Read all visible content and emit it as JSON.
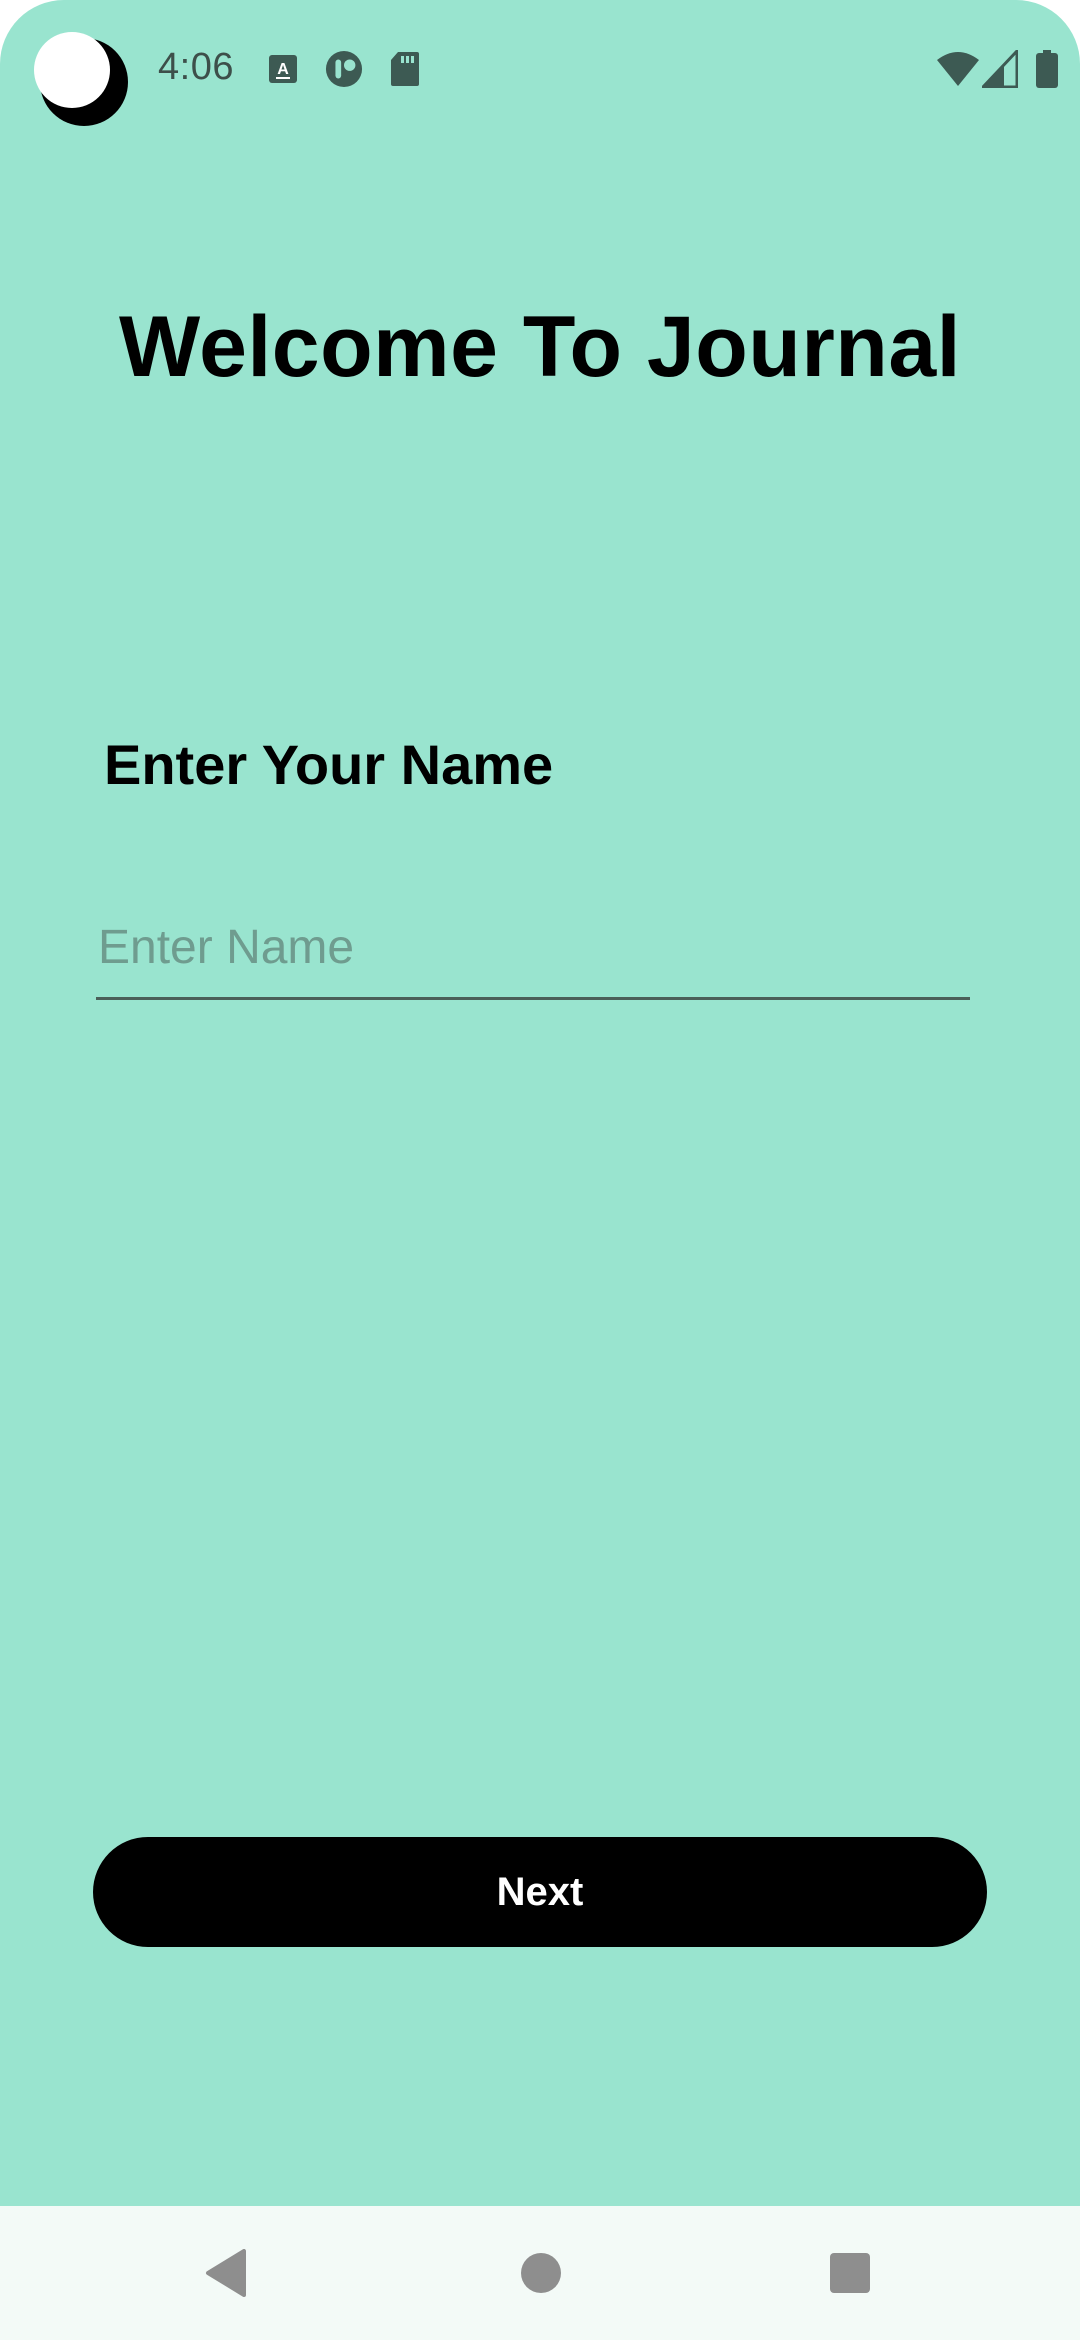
{
  "status_bar": {
    "time": "4:06",
    "icons": [
      "keyboard-a-icon",
      "app-notification-icon",
      "sd-card-icon",
      "wifi-icon",
      "cellular-signal-icon",
      "battery-icon"
    ]
  },
  "welcome": {
    "title": "Welcome To Journal"
  },
  "name_form": {
    "label": "Enter Your Name",
    "input_placeholder": "Enter Name",
    "input_value": ""
  },
  "actions": {
    "next_label": "Next"
  },
  "nav_bar": {
    "icons": [
      "back-icon",
      "home-icon",
      "recents-icon"
    ]
  },
  "colors": {
    "background": "#99e4cf",
    "primary_button": "#000000",
    "button_text": "#ffffff",
    "nav_bar": "#f3faf7"
  }
}
